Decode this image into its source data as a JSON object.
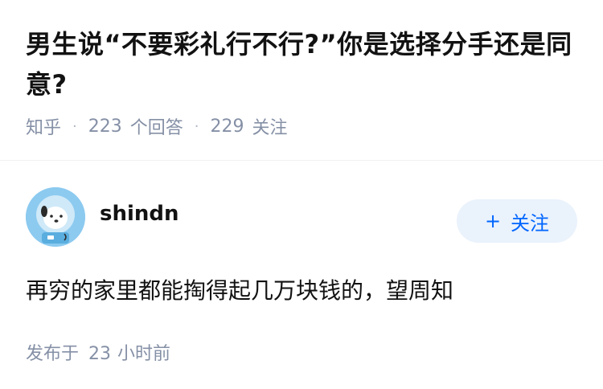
{
  "question": {
    "title": "男生说“不要彩礼行不行?”你是选择分手还是同意?",
    "source": "知乎",
    "answers_count": "223",
    "answers_label": "个回答",
    "followers_count": "229",
    "followers_label": "关注"
  },
  "answer": {
    "author": "shindn",
    "follow_button": "关注",
    "content": "再穷的家里都能掏得起几万块钱的，望周知",
    "posted_label": "发布于",
    "posted_value": "23",
    "posted_unit": "小时前"
  },
  "colors": {
    "accent": "#0066ff",
    "meta": "#8590a6",
    "follow_bg": "#eaf2fc"
  }
}
